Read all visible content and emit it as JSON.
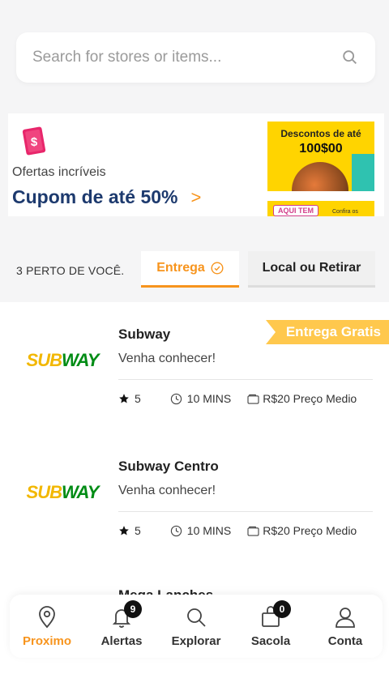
{
  "search": {
    "placeholder": "Search for stores or items...",
    "icon": "search-icon"
  },
  "promo": {
    "subtitle": "Ofertas incríveis",
    "title": "Cupom de até 50%",
    "chevron": ">",
    "ticket_symbol": "$",
    "card": {
      "line1": "Descontos de até",
      "line2": "100$00"
    },
    "card2": {
      "pill": "AQUI TEM",
      "tiny": "Confira os"
    }
  },
  "filters": {
    "near_label": "3 PERTO DE VOCÊ.",
    "tab_delivery": "Entrega",
    "tab_pickup": "Local ou Retirar"
  },
  "stores": [
    {
      "name": "Subway",
      "logo": {
        "sub": "SUB",
        "way": "WAY"
      },
      "description": "Venha conhecer!",
      "rating": "5",
      "time": "10 MINS",
      "price": "R$20 Preço Medio",
      "badge": "Entrega Gratis"
    },
    {
      "name": "Subway Centro",
      "logo": {
        "sub": "SUB",
        "way": "WAY"
      },
      "description": "Venha conhecer!",
      "rating": "5",
      "time": "10 MINS",
      "price": "R$20 Preço Medio"
    }
  ],
  "partial_store_name": "Mega Lanches",
  "nav": [
    {
      "label": "Proximo",
      "icon": "location-pin-icon",
      "active": true
    },
    {
      "label": "Alertas",
      "icon": "bell-icon",
      "badge": "9"
    },
    {
      "label": "Explorar",
      "icon": "search-icon"
    },
    {
      "label": "Sacola",
      "icon": "bag-icon",
      "badge": "0"
    },
    {
      "label": "Conta",
      "icon": "user-icon"
    }
  ],
  "colors": {
    "accent": "#f7941d",
    "promo_title": "#1d3a6e",
    "badge": "#ffc84d",
    "star": "#111111"
  }
}
